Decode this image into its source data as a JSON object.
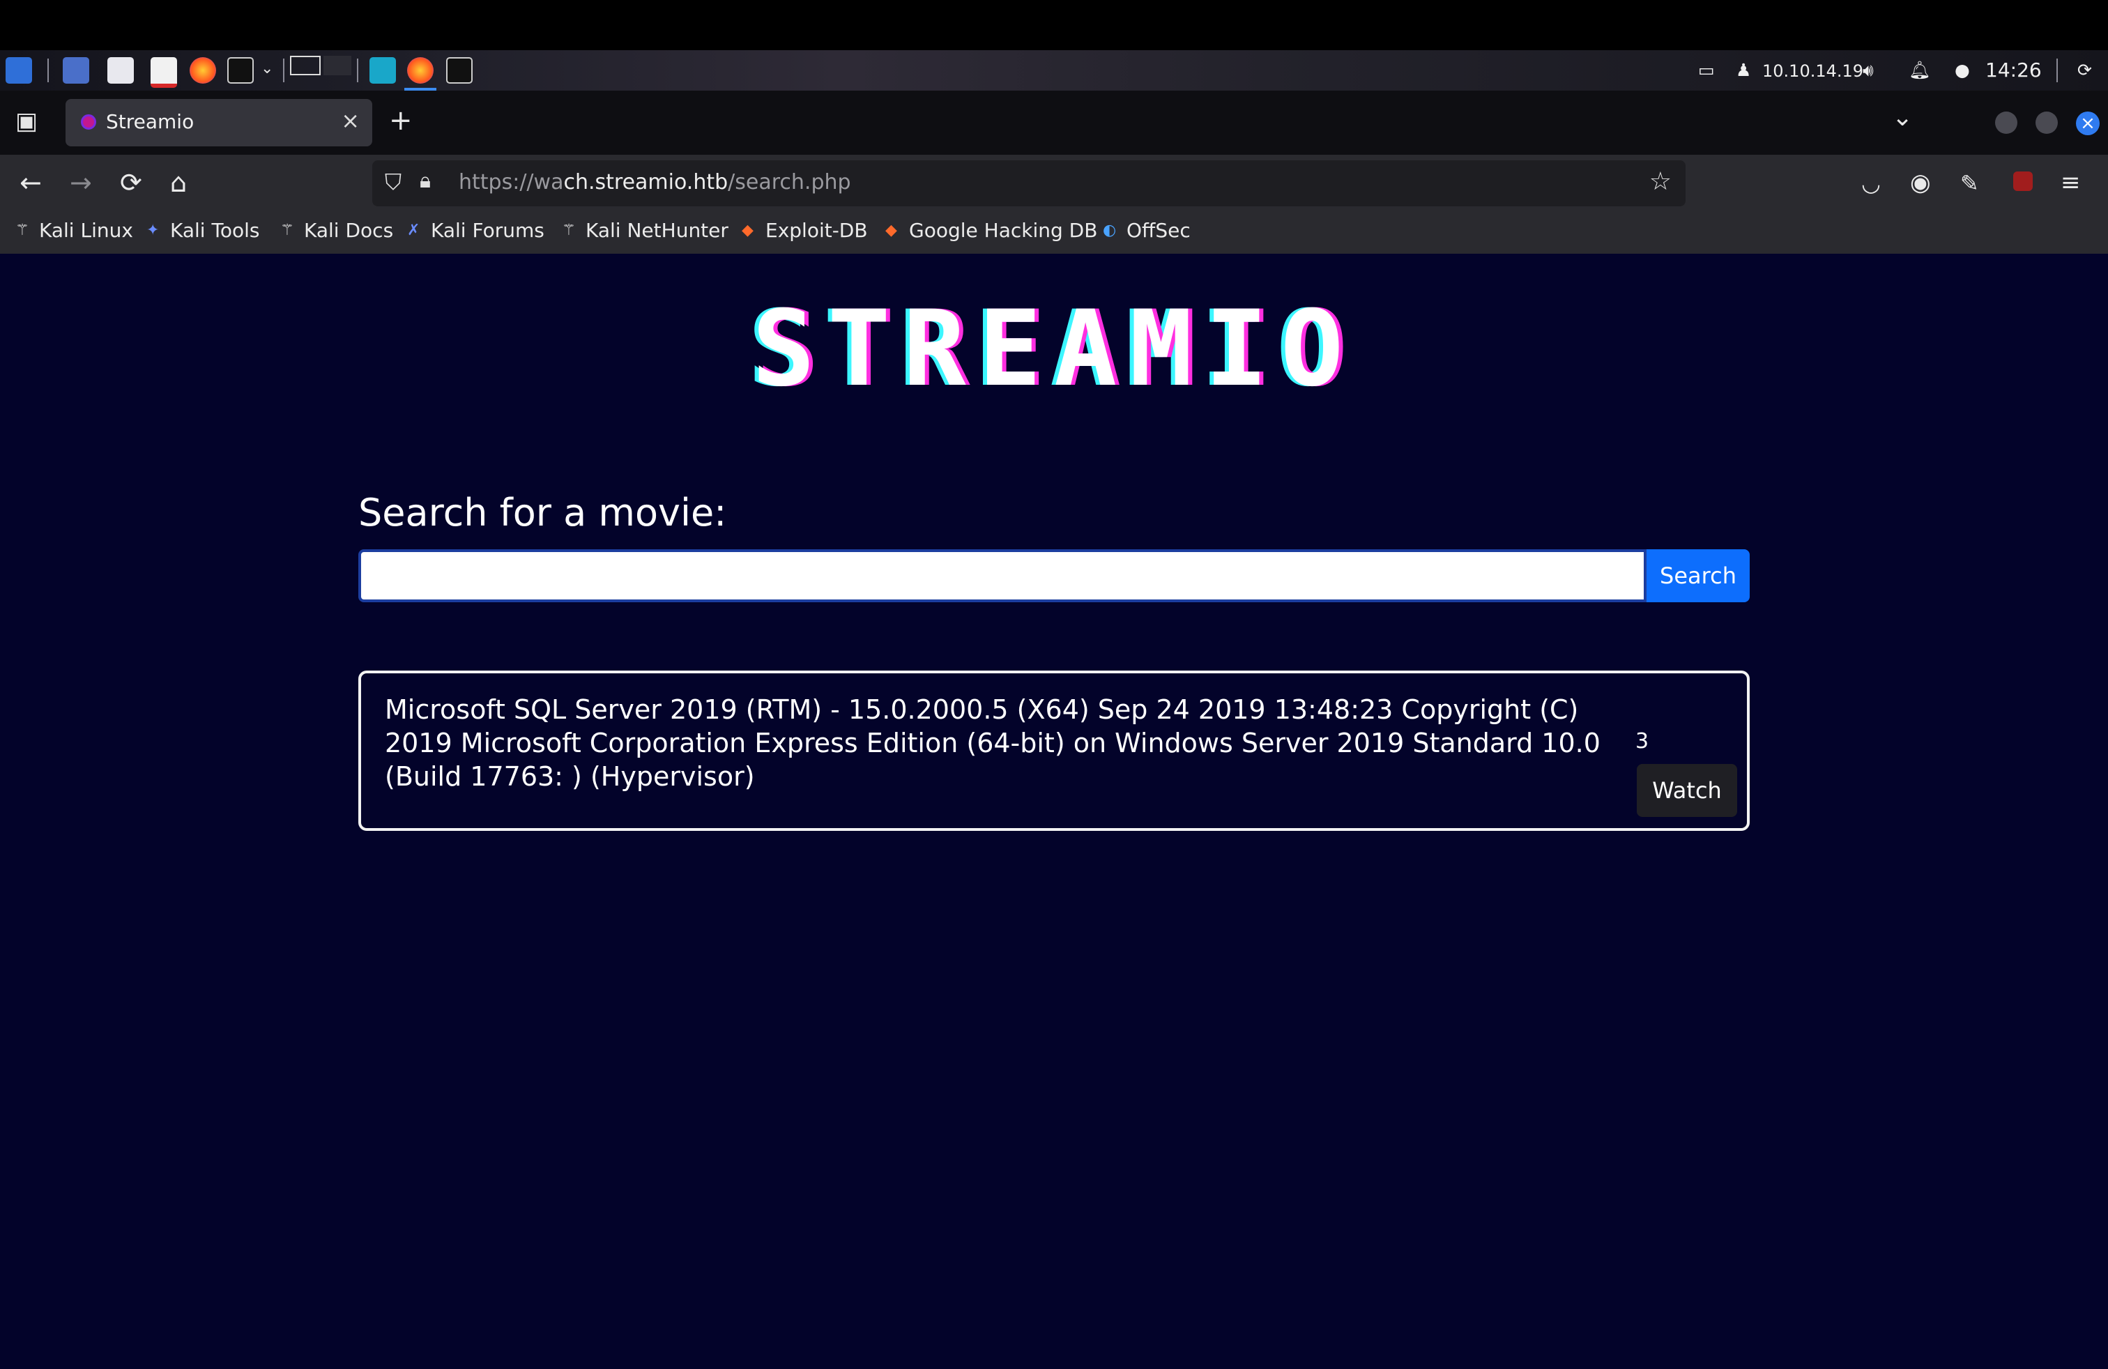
{
  "panel": {
    "ip": "10.10.14.19",
    "time": "14:26"
  },
  "browser": {
    "tab_title": "Streamio",
    "url_prefix": "https://wa",
    "url_host_rest": "ch.streamio.htb",
    "url_path": "/search.php",
    "url_full": "https://watch.streamio.htb/search.php"
  },
  "bookmarks": [
    {
      "label": "Kali Linux",
      "icon": "kali-dragon-icon"
    },
    {
      "label": "Kali Tools",
      "icon": "kali-tools-icon"
    },
    {
      "label": "Kali Docs",
      "icon": "kali-dragon-icon"
    },
    {
      "label": "Kali Forums",
      "icon": "kali-forums-icon"
    },
    {
      "label": "Kali NetHunter",
      "icon": "kali-dragon-icon"
    },
    {
      "label": "Exploit-DB",
      "icon": "exploit-db-icon"
    },
    {
      "label": "Google Hacking DB",
      "icon": "exploit-db-icon"
    },
    {
      "label": "OffSec",
      "icon": "offsec-icon"
    }
  ],
  "page": {
    "logo": "STREAMIO",
    "search_label": "Search for a movie:",
    "search_value": "",
    "search_button": "Search",
    "results": [
      {
        "title": "Microsoft SQL Server 2019 (RTM) - 15.0.2000.5 (X64) Sep 24 2019 13:48:23 Copyright (C) 2019 Microsoft Corporation Express Edition (64-bit) on Windows Server 2019 Standard 10.0 (Build 17763: ) (Hypervisor)",
        "count": "3",
        "button": "Watch"
      }
    ]
  },
  "colors": {
    "page_bg": "#03032a",
    "search_button": "#0d6efd",
    "logo_pink": "#ff2fe0",
    "logo_cyan": "#3cf6ff"
  }
}
